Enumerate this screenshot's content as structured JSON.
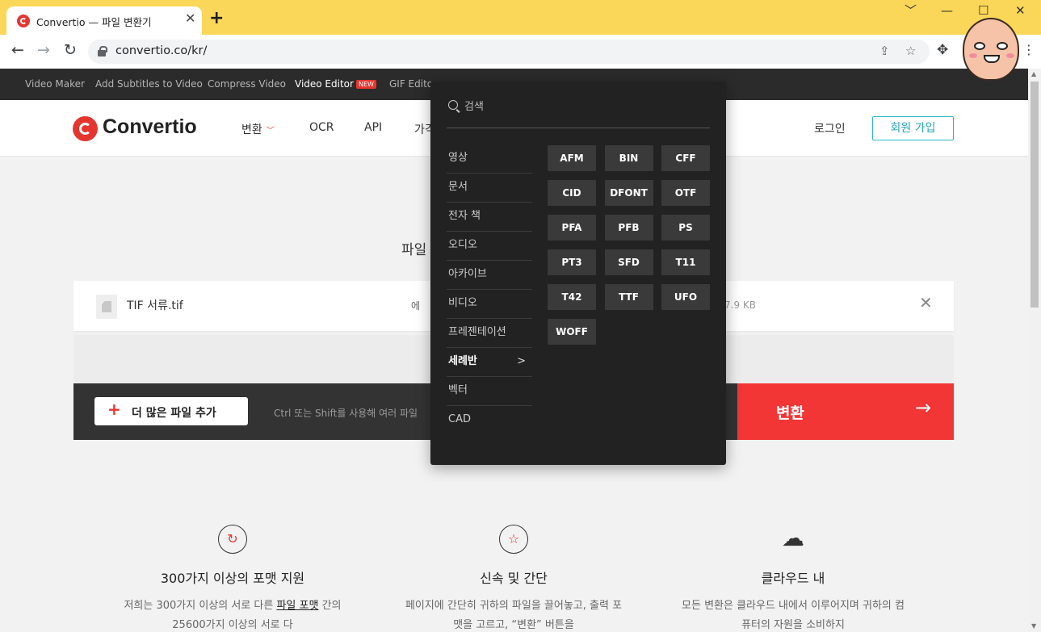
{
  "browser": {
    "tab_title": "Convertio — 파일 변환기",
    "tab_close": "✕",
    "new_tab": "+",
    "url": "convertio.co/kr/",
    "window_controls": [
      "﹀",
      "—",
      "☐",
      "✕"
    ],
    "nav": {
      "back": "←",
      "forward": "→",
      "reload": "↻"
    },
    "icons": {
      "share": "⇪",
      "bookmark": "☆",
      "extensions": "✥",
      "menu": "⋮"
    }
  },
  "promo_bar": {
    "items": [
      {
        "label": "Video Maker"
      },
      {
        "label": "Add Subtitles to Video"
      },
      {
        "label": "Compress Video"
      },
      {
        "label": "Video Editor",
        "badge": "NEW"
      },
      {
        "label": "GIF Editor"
      }
    ]
  },
  "header": {
    "logo_text": "Convertio",
    "nav": [
      "변환",
      "OCR",
      "API",
      "가격"
    ],
    "login": "로그인",
    "signup": "회원 가입"
  },
  "hero": {
    "text": "파일"
  },
  "file_row": {
    "name": "TIF 서류.tif",
    "to_label": "에",
    "size": "7.9 KB",
    "close": "✕"
  },
  "action_bar": {
    "add_more": "더 많은 파일 추가",
    "add_plus": "+",
    "hint": "Ctrl 또는 Shift를 사용해 여러 파일",
    "convert": "변환",
    "convert_arrow": "→"
  },
  "features": [
    {
      "icon": "↻",
      "title": "300가지 이상의 포맷 지원",
      "desc_pre": "저희는 300가지 이상의 서로 다른 ",
      "desc_link": "파일 포맷",
      "desc_post": " 간의 25600가지 이상의 서로 다"
    },
    {
      "icon": "☆",
      "title": "신속 및 간단",
      "desc": "페이지에 간단히 귀하의 파일을 끌어놓고, 출력 포맷을 고르고, “변환” 버튼을"
    },
    {
      "icon": "☁",
      "title": "클라우드 내",
      "desc": "모든 변환은 클라우드 내에서 이루어지며 귀하의 컴퓨터의 자원을 소비하지"
    }
  ],
  "dropdown": {
    "search_placeholder": "검색",
    "categories": [
      "영상",
      "문서",
      "전자 책",
      "오디오",
      "아카이브",
      "비디오",
      "프레젠테이션",
      "세례반",
      "벡터",
      "CAD"
    ],
    "active_category": "세례반",
    "active_chevron": ">",
    "formats": [
      "AFM",
      "BIN",
      "CFF",
      "CID",
      "DFONT",
      "OTF",
      "PFA",
      "PFB",
      "PS",
      "PT3",
      "SFD",
      "T11",
      "T42",
      "TTF",
      "UFO",
      "WOFF"
    ]
  },
  "colors": {
    "accent_red": "#e5352f",
    "convert_red": "#f23535",
    "signup_teal": "#2fb5c9",
    "browser_yellow": "#fad759",
    "dropdown_bg": "#222222"
  }
}
